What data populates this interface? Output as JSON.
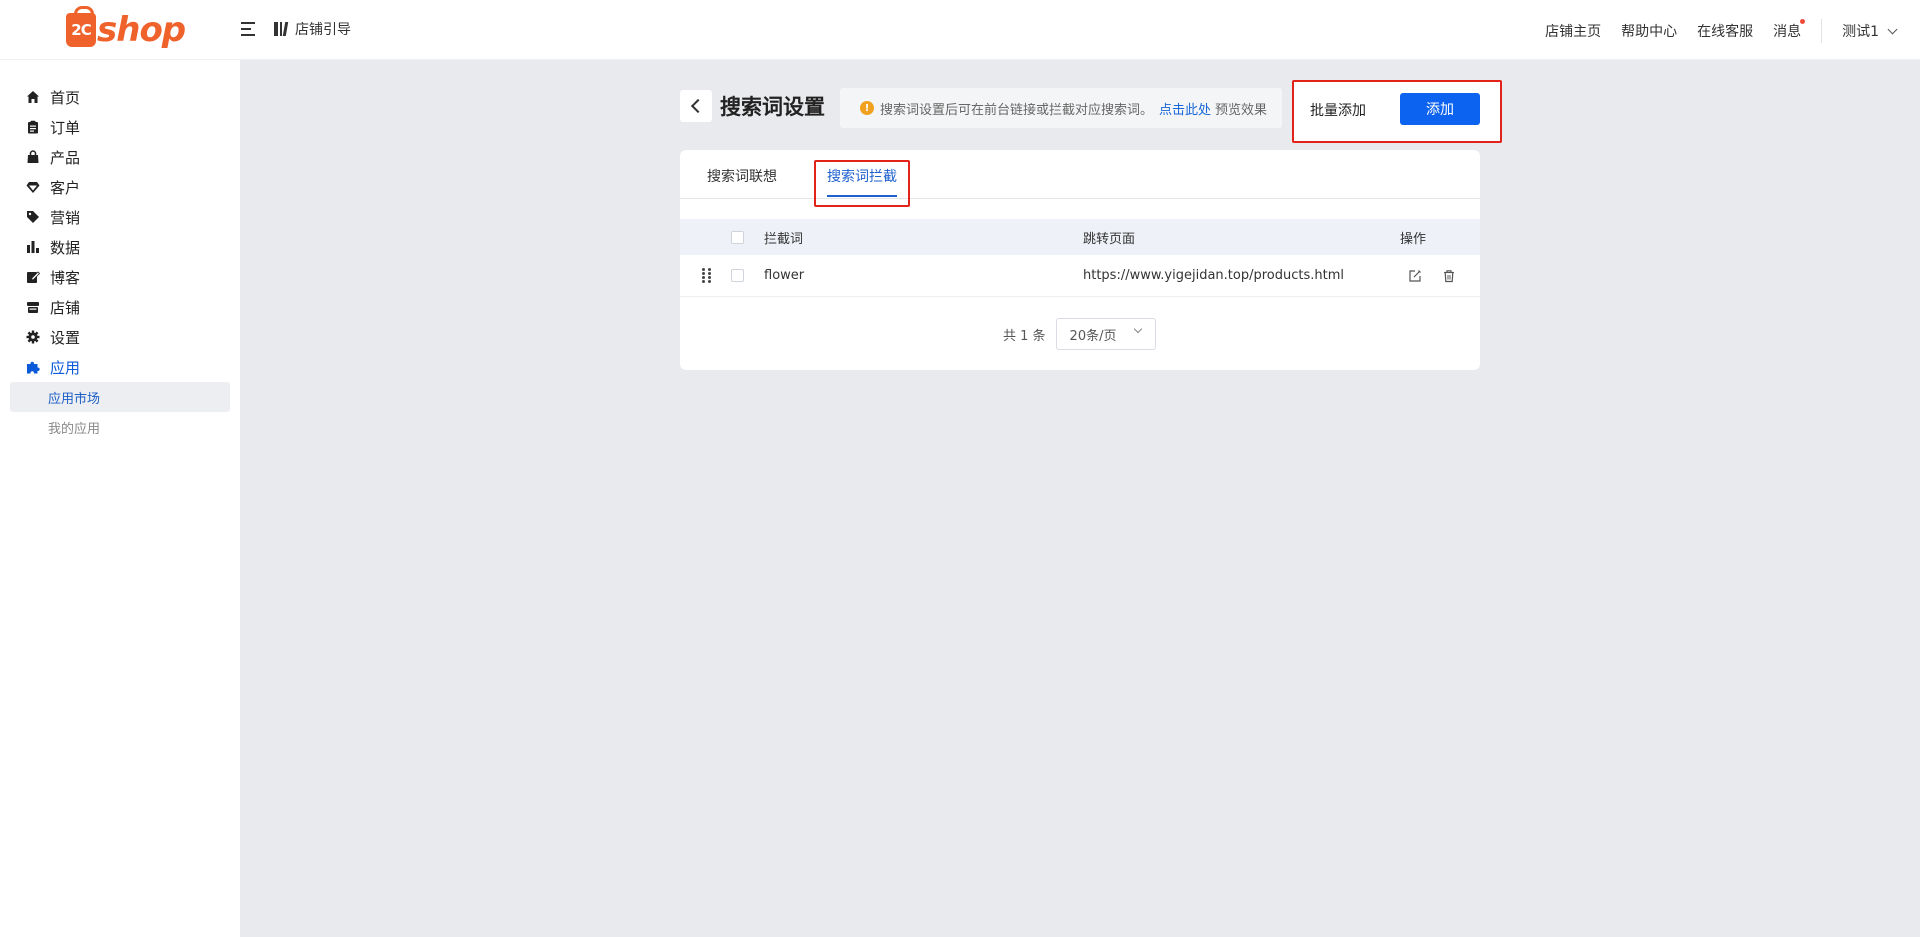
{
  "header": {
    "logo_mark": "2C",
    "logo_text": "shop",
    "guide_label": "店铺引导",
    "links": {
      "store_home": "店铺主页",
      "help_center": "帮助中心",
      "online_service": "在线客服",
      "messages": "消息"
    },
    "user_name": "测试1"
  },
  "sidebar": {
    "items": [
      {
        "label": "首页",
        "icon": "home-icon"
      },
      {
        "label": "订单",
        "icon": "clipboard-icon"
      },
      {
        "label": "产品",
        "icon": "bag-icon"
      },
      {
        "label": "客户",
        "icon": "diamond-icon"
      },
      {
        "label": "营销",
        "icon": "tag-icon"
      },
      {
        "label": "数据",
        "icon": "bar-chart-icon"
      },
      {
        "label": "博客",
        "icon": "edit-icon"
      },
      {
        "label": "店铺",
        "icon": "store-icon"
      },
      {
        "label": "设置",
        "icon": "gear-icon"
      },
      {
        "label": "应用",
        "icon": "puzzle-icon"
      }
    ],
    "sub_items": [
      {
        "label": "应用市场"
      },
      {
        "label": "我的应用"
      }
    ],
    "active_color": "#0a5ad9"
  },
  "page": {
    "title": "搜索词设置",
    "notice_text": "搜索词设置后可在前台链接或拦截对应搜索词。",
    "notice_link": "点击此处",
    "notice_after": "预览效果",
    "batch_add": "批量添加",
    "add": "添加",
    "accent": "#0c63f0"
  },
  "tabs": [
    {
      "label": "搜索词联想"
    },
    {
      "label": "搜索词拦截",
      "active": true
    }
  ],
  "table": {
    "columns": [
      "拦截词",
      "跳转页面",
      "操作"
    ],
    "rows": [
      {
        "word": "flower",
        "page": "https://www.yigejidan.top/products.html"
      }
    ]
  },
  "pagination": {
    "total": "共 1 条",
    "page_size": "20条/页"
  }
}
